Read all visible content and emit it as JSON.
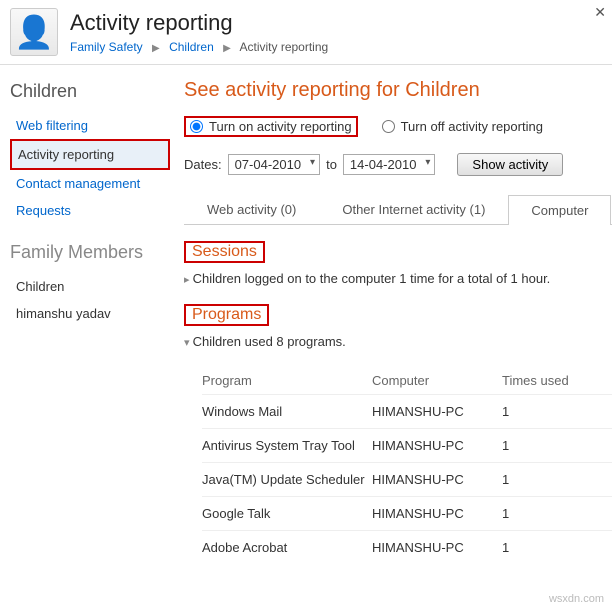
{
  "header": {
    "title": "Activity reporting",
    "breadcrumb": {
      "root": "Family Safety",
      "mid": "Children",
      "leaf": "Activity reporting"
    }
  },
  "sidebar": {
    "heading": "Children",
    "items": [
      {
        "label": "Web filtering"
      },
      {
        "label": "Activity reporting"
      },
      {
        "label": "Contact management"
      },
      {
        "label": "Requests"
      }
    ],
    "members_heading": "Family Members",
    "members": [
      {
        "label": "Children"
      },
      {
        "label": "himanshu yadav"
      }
    ]
  },
  "main": {
    "title": "See activity reporting for Children",
    "radio_on": "Turn on activity reporting",
    "radio_off": "Turn off activity reporting",
    "dates_label": "Dates:",
    "date_from": "07-04-2010",
    "date_to_label": "to",
    "date_to": "14-04-2010",
    "show_btn": "Show activity",
    "tabs": [
      {
        "label": "Web activity (0)"
      },
      {
        "label": "Other Internet activity (1)"
      },
      {
        "label": "Computer"
      }
    ],
    "sessions_head": "Sessions",
    "sessions_text": "Children logged on to the computer 1 time for a total of 1 hour.",
    "programs_head": "Programs",
    "programs_text": "Children used 8 programs.",
    "columns": {
      "program": "Program",
      "computer": "Computer",
      "times": "Times used"
    },
    "programs": [
      {
        "name": "Windows Mail",
        "computer": "HIMANSHU-PC",
        "times": "1"
      },
      {
        "name": "Antivirus System Tray Tool",
        "computer": "HIMANSHU-PC",
        "times": "1"
      },
      {
        "name": "Java(TM) Update Scheduler",
        "computer": "HIMANSHU-PC",
        "times": "1"
      },
      {
        "name": "Google Talk",
        "computer": "HIMANSHU-PC",
        "times": "1"
      },
      {
        "name": "Adobe Acrobat",
        "computer": "HIMANSHU-PC",
        "times": "1"
      }
    ]
  },
  "watermark": "wsxdn.com"
}
